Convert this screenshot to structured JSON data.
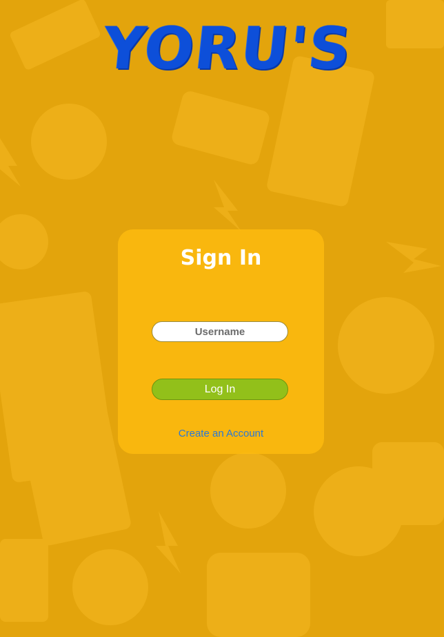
{
  "logo": {
    "text": "YORU'S"
  },
  "signin": {
    "title": "Sign In",
    "username_placeholder": "Username",
    "username_value": "",
    "login_label": "Log In",
    "create_account_label": "Create an Account"
  },
  "colors": {
    "background": "#e3a40c",
    "card": "#ffbd10",
    "logo": "#0d4fd9",
    "login_button": "#92c01a",
    "link": "#2a78d6"
  }
}
